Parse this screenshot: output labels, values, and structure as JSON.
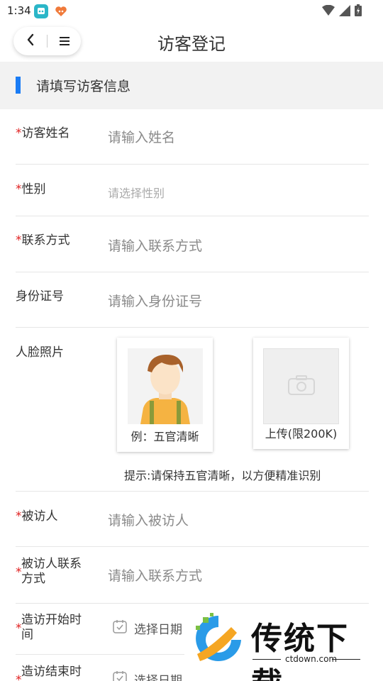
{
  "status_bar": {
    "time": "1:34"
  },
  "header": {
    "title": "访客登记"
  },
  "section": {
    "title": "请填写访客信息"
  },
  "form": {
    "required_mark": "*",
    "name": {
      "label": "访客姓名",
      "placeholder": "请输入姓名"
    },
    "gender": {
      "label": "性别",
      "placeholder": "请选择性别"
    },
    "contact": {
      "label": "联系方式",
      "placeholder": "请输入联系方式"
    },
    "id_number": {
      "label": "身份证号",
      "placeholder": "请输入身份证号"
    },
    "face_photo": {
      "label": "人脸照片",
      "example_caption": "例：五官清晰",
      "upload_caption": "上传(限200K)",
      "hint": "提示:请保持五官清晰，以方便精准识别"
    },
    "visitee": {
      "label": "被访人",
      "placeholder": "请输入被访人"
    },
    "visitee_contact": {
      "label_line1": "被访人联系",
      "label_line2": "方式",
      "placeholder": "请输入联系方式"
    },
    "start_time": {
      "label_line1": "造访开始时",
      "label_line2": "间",
      "button": "选择日期"
    },
    "end_time": {
      "label_line1": "造访结束时",
      "button": "选择日期"
    }
  },
  "watermark": {
    "text": "传统下载",
    "url": "ctdown.com"
  },
  "colors": {
    "accent": "#1a7cf5",
    "required": "#e02020",
    "section_bg": "#f2f2f2"
  }
}
